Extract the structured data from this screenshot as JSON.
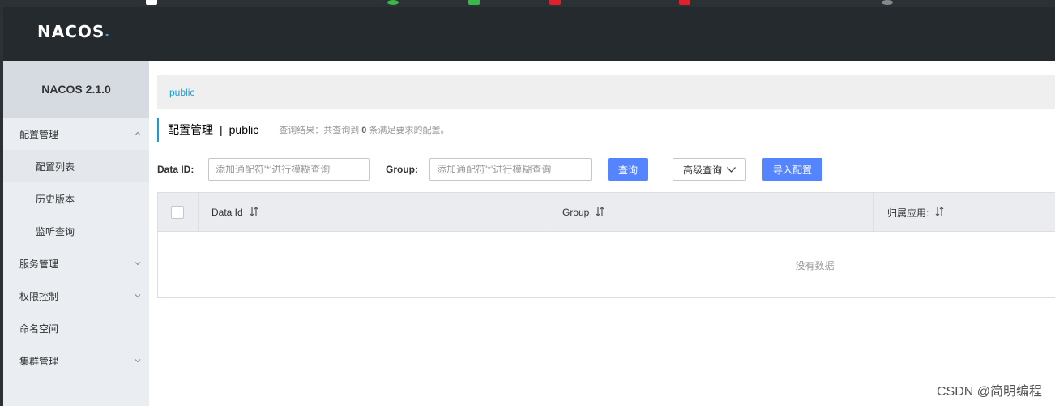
{
  "colors": {
    "topbar": "#252a2f",
    "sidebar": "#eaedf1",
    "accent": "#1c9bd4",
    "primary_button": "#5584ff"
  },
  "header": {
    "logo_text": "NACOS",
    "logo_dot": "."
  },
  "sidebar": {
    "version": "NACOS 2.1.0",
    "items": [
      {
        "label": "配置管理",
        "icon": "chevron-up-icon"
      },
      {
        "label": "配置列表"
      },
      {
        "label": "历史版本"
      },
      {
        "label": "监听查询"
      },
      {
        "label": "服务管理",
        "icon": "chevron-down-icon"
      },
      {
        "label": "权限控制",
        "icon": "chevron-down-icon"
      },
      {
        "label": "命名空间"
      },
      {
        "label": "集群管理",
        "icon": "chevron-down-icon"
      }
    ]
  },
  "main": {
    "namespace_tab": "public",
    "title": "配置管理",
    "title_sep": "|",
    "title_namespace": "public",
    "result_prefix": "查询结果：共查询到 ",
    "result_count": "0",
    "result_suffix": " 条满足要求的配置。",
    "filters": {
      "data_id_label": "Data ID:",
      "data_id_placeholder": "添加通配符'*'进行模糊查询",
      "group_label": "Group:",
      "group_placeholder": "添加通配符'*'进行模糊查询",
      "query_button": "查询",
      "advanced_button": "高级查询",
      "import_button": "导入配置"
    },
    "table": {
      "columns": [
        "Data Id",
        "Group",
        "归属应用:"
      ],
      "empty_text": "没有数据"
    }
  },
  "watermark": "CSDN @简明编程"
}
